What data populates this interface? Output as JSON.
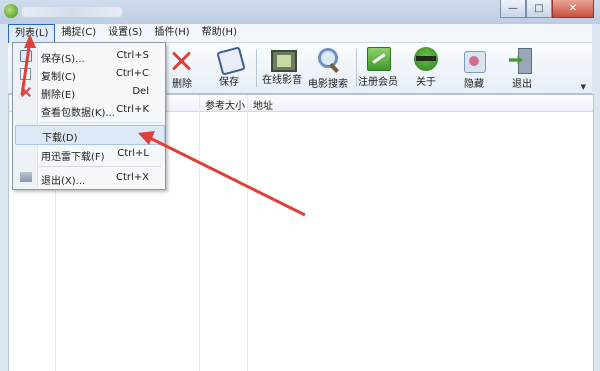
{
  "window": {
    "close_glyph": "✕",
    "maximize_glyph": "□",
    "minimize_glyph": "—"
  },
  "menubar": [
    {
      "label": "列表(L)"
    },
    {
      "label": "捕捉(C)"
    },
    {
      "label": "设置(S)"
    },
    {
      "label": "插件(H)"
    },
    {
      "label": "帮助(H)"
    }
  ],
  "toolbar": {
    "delete_label": "删除",
    "save_label": "保存",
    "online_video_label": "在线影音",
    "movie_search_label": "电影搜索",
    "register_label": "注册会员",
    "about_label": "关于",
    "hide_label": "隐藏",
    "exit_label": "退出"
  },
  "table": {
    "headers": [
      "参考大小",
      "地址"
    ]
  },
  "dropdown": {
    "items": [
      {
        "label": "保存(S)...",
        "shortcut": "Ctrl+S",
        "icon": "save-icon"
      },
      {
        "label": "复制(C)",
        "shortcut": "Ctrl+C",
        "icon": "copy-icon"
      },
      {
        "label": "删除(E)",
        "shortcut": "Del",
        "icon": "delete-icon"
      },
      {
        "label": "查看包数据(K)...",
        "shortcut": "Ctrl+K",
        "icon": ""
      },
      {
        "label": "下载(D)",
        "shortcut": "",
        "icon": ""
      },
      {
        "label": "用迅雷下载(F)",
        "shortcut": "Ctrl+L",
        "icon": ""
      },
      {
        "label": "退出(X)...",
        "shortcut": "Ctrl+X",
        "icon": "exit-icon"
      }
    ]
  },
  "colors": {
    "annotation_arrow": "#e0403a",
    "highlight": "#dde8f6"
  }
}
